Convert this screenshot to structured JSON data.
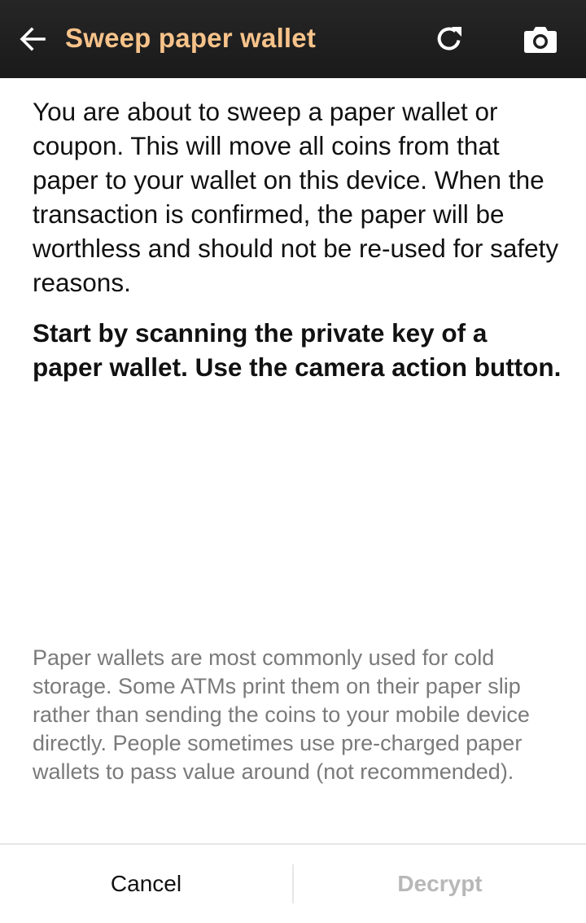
{
  "toolbar": {
    "title": "Sweep paper wallet",
    "back_icon": "arrow-left-icon",
    "refresh_icon": "refresh-icon",
    "camera_icon": "camera-icon",
    "title_color": "#f7c38a",
    "background_color": "#1f1f1f"
  },
  "main": {
    "intro_text": "You are about to sweep a paper wallet or coupon. This will move all coins from that paper to your wallet on this device. When the transaction is confirmed, the paper will be worthless and should not be re-used for safety reasons.",
    "instruction_text": "Start by scanning the private key of a paper wallet. Use the camera action button.",
    "note_text": "Paper wallets are most commonly used for cold storage. Some ATMs print them on their paper slip rather than sending the coins to your mobile device directly. People sometimes use pre-charged paper wallets to pass value around (not recommended)."
  },
  "buttons": {
    "cancel_label": "Cancel",
    "decrypt_label": "Decrypt",
    "decrypt_enabled": false
  }
}
